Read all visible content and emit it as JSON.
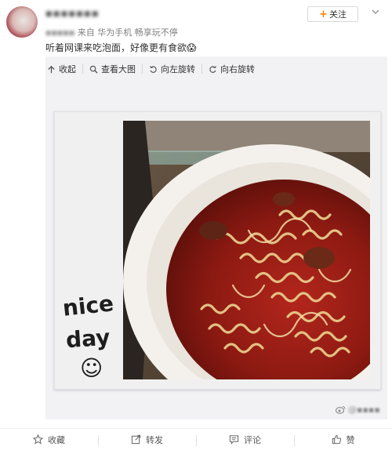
{
  "post": {
    "username": "▪▪▪▪▪▪▪",
    "meta_blurred": "▪▪▪▪▪",
    "meta_source": "来自 华为手机 畅享玩不停",
    "text": "听着网课来吃泡面，好像更有食欲😱"
  },
  "header": {
    "follow_plus": "+",
    "follow_label": "关注"
  },
  "toolbar": {
    "collapse": "收起",
    "view_large": "查看大图",
    "rotate_left": "向左旋转",
    "rotate_right": "向右旋转"
  },
  "photo": {
    "caption_line1": "nice",
    "caption_line2": "day",
    "caption_face": "☺"
  },
  "watermark": {
    "text": "@▪▪▪▪"
  },
  "actions": {
    "favorite": "收藏",
    "repost": "转发",
    "comment": "评论",
    "like": "赞"
  },
  "colors": {
    "accent_orange": "#ff8200",
    "text_gray": "#808080",
    "media_bg": "#f2f2f5"
  },
  "icons": [
    "chevron-down-icon",
    "collapse-icon",
    "zoom-icon",
    "rotate-left-icon",
    "rotate-right-icon",
    "star-icon",
    "repost-icon",
    "comment-icon",
    "thumbs-up-icon",
    "weibo-icon"
  ]
}
